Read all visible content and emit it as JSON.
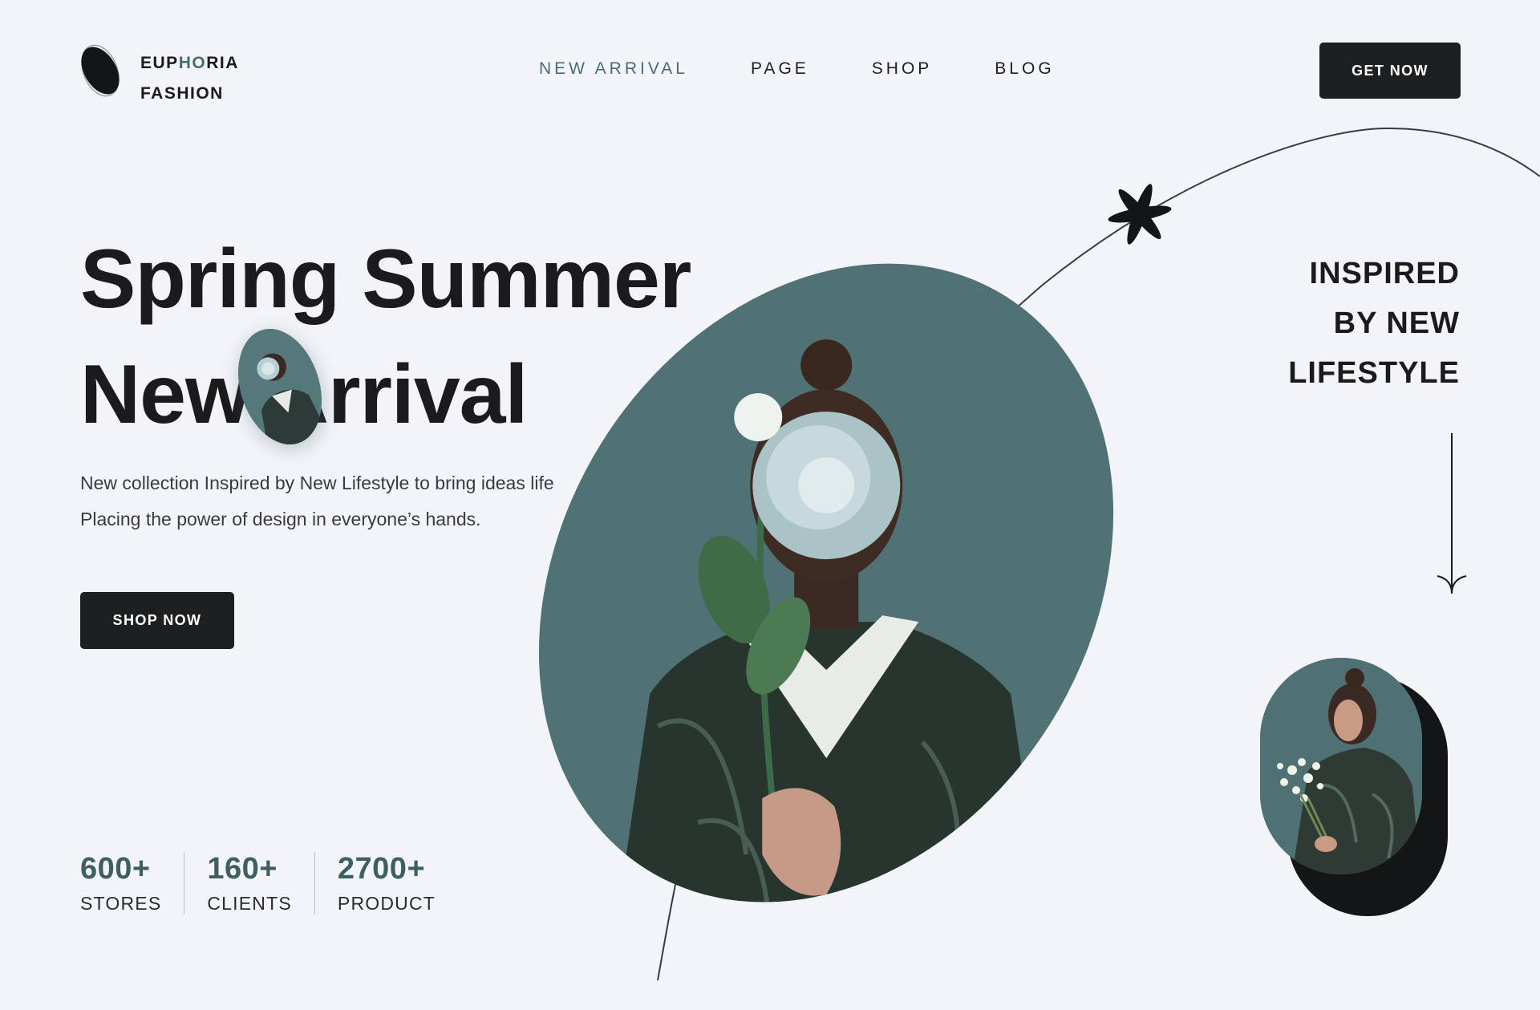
{
  "brand": {
    "line1_a": "EUP",
    "line1_b": "HO",
    "line1_c": "RIA",
    "line2": "FASHION",
    "accent_color": "#4a6c6e"
  },
  "nav": {
    "items": [
      {
        "label": "NEW ARRIVAL",
        "active": true
      },
      {
        "label": "PAGE",
        "active": false
      },
      {
        "label": "SHOP",
        "active": false
      },
      {
        "label": "BLOG",
        "active": false
      }
    ]
  },
  "header": {
    "cta_label": "GET NOW"
  },
  "hero": {
    "headline_line1": "Spring Summer",
    "headline_line2": "New Arrival",
    "description_line1": "New collection Inspired by New Lifestyle to bring ideas life",
    "description_line2": "Placing the power of design in everyone’s hands.",
    "cta_label": "SHOP NOW"
  },
  "stats": [
    {
      "value": "600+",
      "label": "STORES"
    },
    {
      "value": "160+",
      "label": "CLIENTS"
    },
    {
      "value": "2700+",
      "label": "PRODUCT"
    }
  ],
  "side": {
    "line1": "INSPIRED",
    "line2": "BY NEW",
    "line3": "LIFESTYLE"
  },
  "icons": {
    "logo": "ellipse-logo-icon",
    "decor": "asterisk-icon",
    "scroll": "arrow-down-icon"
  },
  "colors": {
    "teal": "#507274",
    "dark": "#1e1f21",
    "background": "#f3f4f8"
  }
}
